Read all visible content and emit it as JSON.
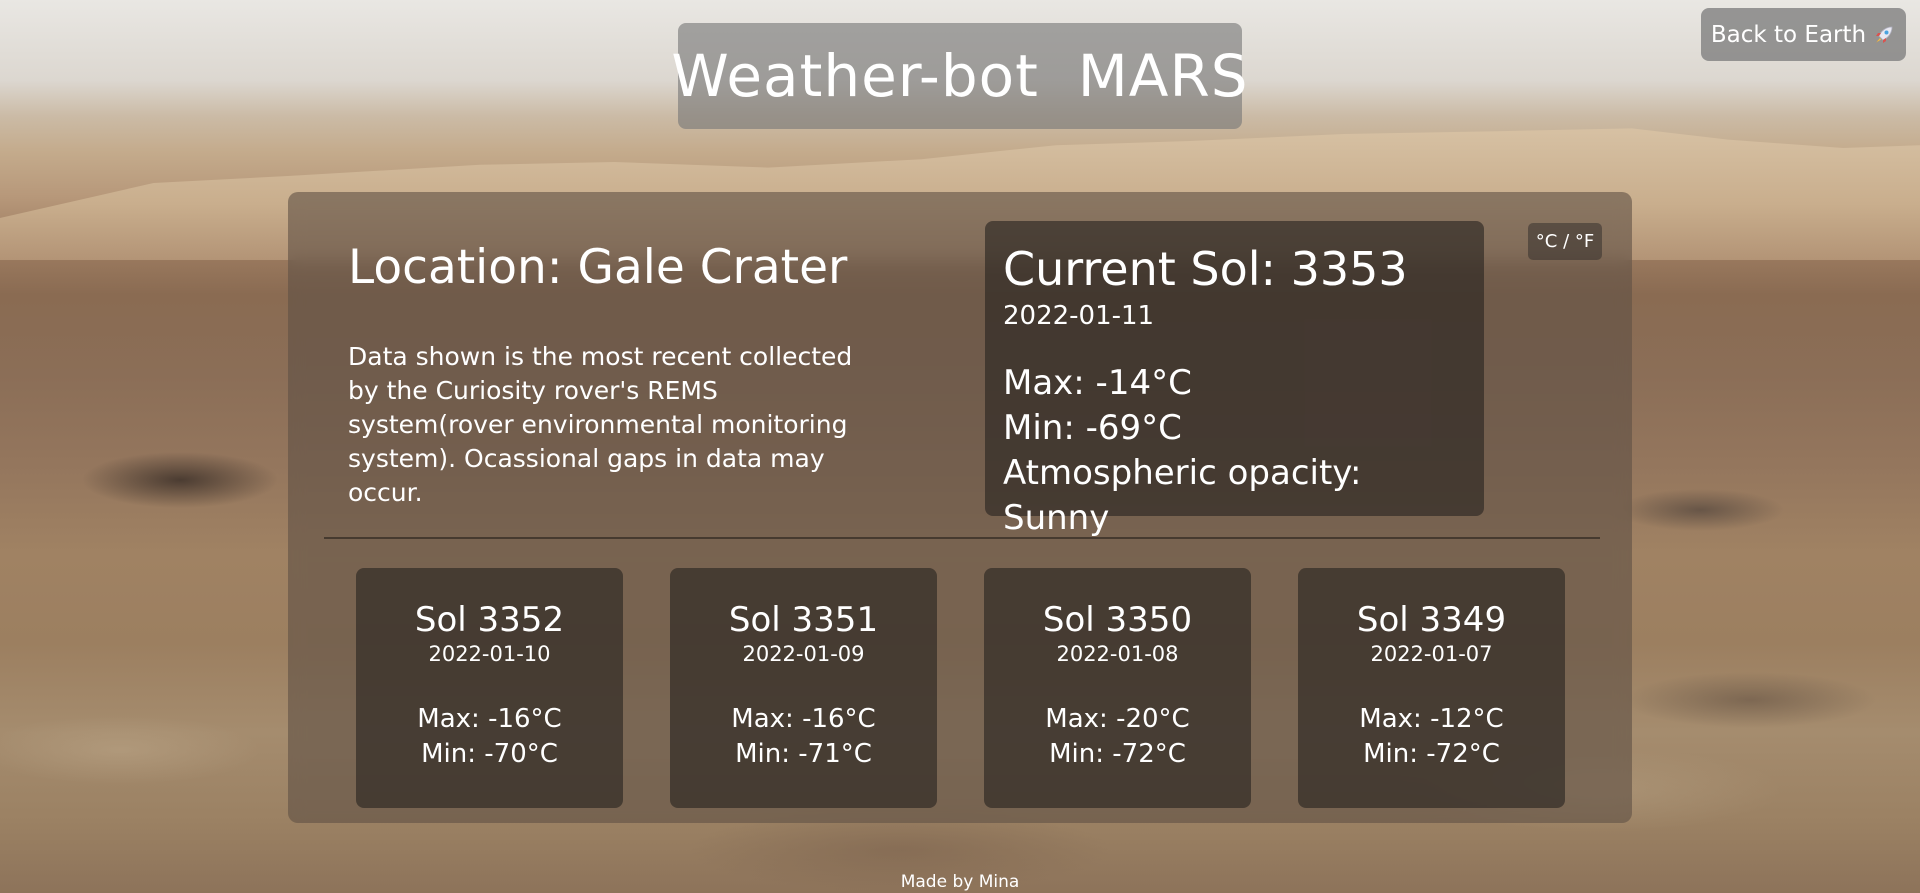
{
  "header": {
    "title": "Weather-bot  MARS",
    "back_button_label": "Back to Earth",
    "back_button_icon": "rocket-icon"
  },
  "location": {
    "label": "Location: Gale Crater",
    "description": "Data shown is the most recent collected by the Curiosity rover's REMS system(rover environmental monitoring system). Ocassional gaps in data may occur."
  },
  "current": {
    "sol": "Current Sol: 3353",
    "date": "2022-01-11",
    "max": "Max: -14°C",
    "min": "Min: -69°C",
    "opacity": "Atmospheric opacity: Sunny"
  },
  "unit_toggle": "°C / °F",
  "forecast": [
    {
      "sol": "Sol 3352",
      "date": "2022-01-10",
      "max": "Max: -16°C",
      "min": "Min: -70°C"
    },
    {
      "sol": "Sol 3351",
      "date": "2022-01-09",
      "max": "Max: -16°C",
      "min": "Min: -71°C"
    },
    {
      "sol": "Sol 3350",
      "date": "2022-01-08",
      "max": "Max: -20°C",
      "min": "Min: -72°C"
    },
    {
      "sol": "Sol 3349",
      "date": "2022-01-07",
      "max": "Max: -12°C",
      "min": "Min: -72°C"
    }
  ],
  "footer": "Made by Mina"
}
